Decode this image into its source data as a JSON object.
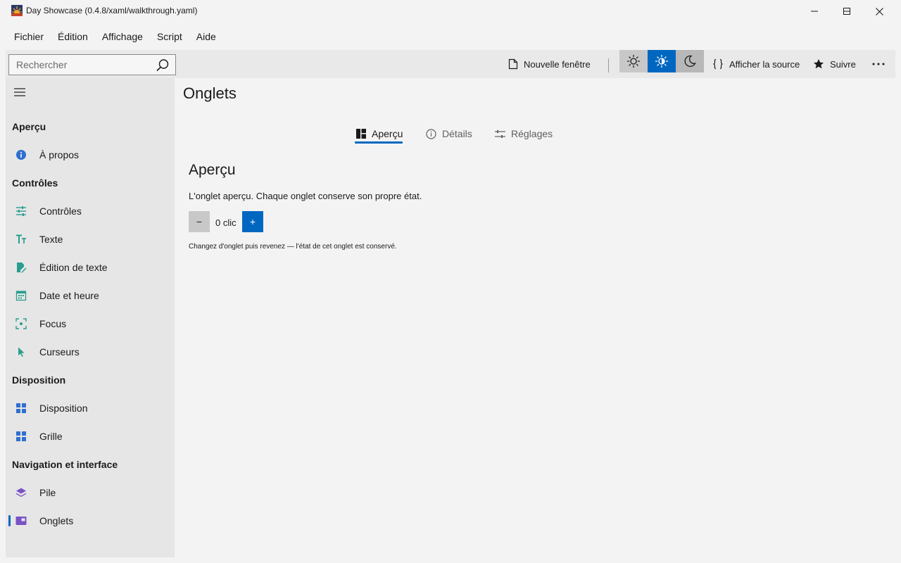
{
  "window": {
    "title": "Day Showcase (0.4.8/xaml/walkthrough.yaml)"
  },
  "menu": [
    "Fichier",
    "Édition",
    "Affichage",
    "Script",
    "Aide"
  ],
  "toolbar": {
    "search_placeholder": "Rechercher",
    "new_window_label": "Nouvelle fenêtre",
    "view_source_label": "Afficher la source",
    "follow_label": "Suivre",
    "theme_selected": "light-high-contrast"
  },
  "sidebar": {
    "groups": [
      {
        "header": "Aperçu",
        "items": [
          {
            "label": "À propos",
            "icon": "info-icon",
            "color": "#0067c0"
          }
        ]
      },
      {
        "header": "Contrôles",
        "items": [
          {
            "label": "Contrôles",
            "icon": "sliders-icon",
            "color": "#2a9d8f"
          },
          {
            "label": "Texte",
            "icon": "text-size-icon",
            "color": "#2a9d8f"
          },
          {
            "label": "Édition de texte",
            "icon": "edit-document-icon",
            "color": "#2a9d8f"
          },
          {
            "label": "Date et heure",
            "icon": "calendar-icon",
            "color": "#2a9d8f"
          },
          {
            "label": "Focus",
            "icon": "focus-icon",
            "color": "#2a9d8f"
          },
          {
            "label": "Curseurs",
            "icon": "cursor-icon",
            "color": "#2a9d8f"
          }
        ]
      },
      {
        "header": "Disposition",
        "items": [
          {
            "label": "Disposition",
            "icon": "layout-grid-icon",
            "color": "#2f6fd0"
          },
          {
            "label": "Grille",
            "icon": "grid-icon",
            "color": "#2f6fd0"
          }
        ]
      },
      {
        "header": "Navigation et interface",
        "items": [
          {
            "label": "Pile",
            "icon": "stack-icon",
            "color": "#7a52c7"
          },
          {
            "label": "Onglets",
            "icon": "tabs-icon",
            "color": "#7a52c7",
            "selected": true
          }
        ]
      }
    ]
  },
  "main": {
    "page_title": "Onglets",
    "tabs": [
      {
        "label": "Aperçu",
        "icon": "dashboard-icon",
        "active": true
      },
      {
        "label": "Détails",
        "icon": "info-circle-icon",
        "active": false
      },
      {
        "label": "Réglages",
        "icon": "settings-sliders-icon",
        "active": false
      }
    ],
    "panel": {
      "title": "Aperçu",
      "description": "L'onglet aperçu. Chaque onglet conserve son propre état.",
      "decrement_label": "−",
      "count_text": "0 clic",
      "increment_label": "+",
      "hint": "Changez d'onglet puis revenez — l'état de cet onglet est conservé."
    }
  },
  "colors": {
    "accent": "#0067c0",
    "sidebar_bg": "#e6e6e6",
    "toolbar_bg": "#e9e9e9",
    "window_bg": "#f3f3f3"
  }
}
